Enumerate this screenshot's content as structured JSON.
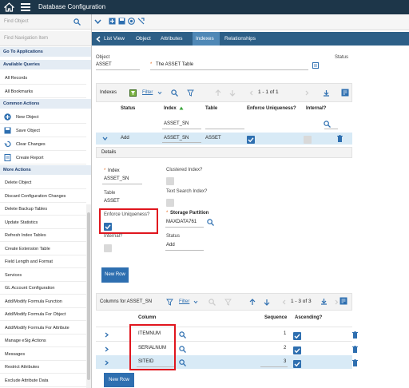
{
  "top_bar": {
    "title": "Database Configuration"
  },
  "sidebar": {
    "find_object_placeholder": "Find Object",
    "find_nav_placeholder": "Find Navigation Item",
    "go_to_apps": "Go To Applications",
    "available_queries_header": "Available Queries",
    "queries": [
      "All Records",
      "All Bookmarks"
    ],
    "common_actions_header": "Common Actions",
    "common_actions": [
      "New Object",
      "Save Object",
      "Clear Changes",
      "Create Report"
    ],
    "more_actions_header": "More Actions",
    "more_actions": [
      "Delete Object",
      "Discard Configuration Changes",
      "Delete Backup Tables",
      "Update Statistics",
      "Refresh Index Tables",
      "Create Extension Table",
      "Field Length and Format",
      "Services",
      "GL Account Configuration",
      "Add/Modify Formula Function",
      "Add/Modify Formula For Object",
      "Add/Modify Formula For Attribute",
      "Manage eSig Actions",
      "Messages",
      "Restrict Attributes",
      "Exclude Attribute Data"
    ]
  },
  "tabs": [
    {
      "label": "List View",
      "active": false
    },
    {
      "label": "Object",
      "active": false
    },
    {
      "label": "Attributes",
      "active": false
    },
    {
      "label": "Indexes",
      "active": true
    },
    {
      "label": "Relationships",
      "active": false
    }
  ],
  "header": {
    "object_label": "Object",
    "object_value": "ASSET",
    "description": "The ASSET Table",
    "status_label": "Status"
  },
  "indexes_table": {
    "title": "Indexes",
    "filter_label": "Filter",
    "pagination": "1 - 1 of 1",
    "columns": [
      "Status",
      "Index",
      "Table",
      "Enforce Uniqueness?",
      "Internal?"
    ],
    "filter_value": "ASSET_SN",
    "row": {
      "status": "Add",
      "index": "ASSET_SN",
      "table": "ASSET"
    }
  },
  "details": {
    "header": "Details",
    "index_label": "Index",
    "index_value": "ASSET_SN",
    "clustered_label": "Clustered Index?",
    "table_label": "Table",
    "table_value": "ASSET",
    "text_search_label": "Text Search Index?",
    "enforce_label": "Enforce Uniqueness?",
    "storage_label": "Storage Partition",
    "storage_value": "MAXDATA761",
    "internal_label": "Internal?",
    "status_label": "Status",
    "status_value": "Add",
    "new_row": "New Row"
  },
  "columns_table": {
    "title": "Columns for ASSET_SN",
    "filter_label": "Filter",
    "pagination": "1 - 3 of 3",
    "col_column": "Column",
    "col_sequence": "Sequence",
    "col_ascending": "Ascending?",
    "rows": [
      {
        "column": "ITEMNUM",
        "sequence": "1"
      },
      {
        "column": "SERIALNUM",
        "sequence": "2"
      },
      {
        "column": "SITEID",
        "sequence": "3"
      }
    ],
    "new_row": "New Row"
  },
  "colors": {
    "topbar": "#1d3649",
    "tabbar": "#2d5f87",
    "active_tab": "#4f88b6",
    "primary": "#2e6fb0",
    "highlight": "#e0161e"
  }
}
